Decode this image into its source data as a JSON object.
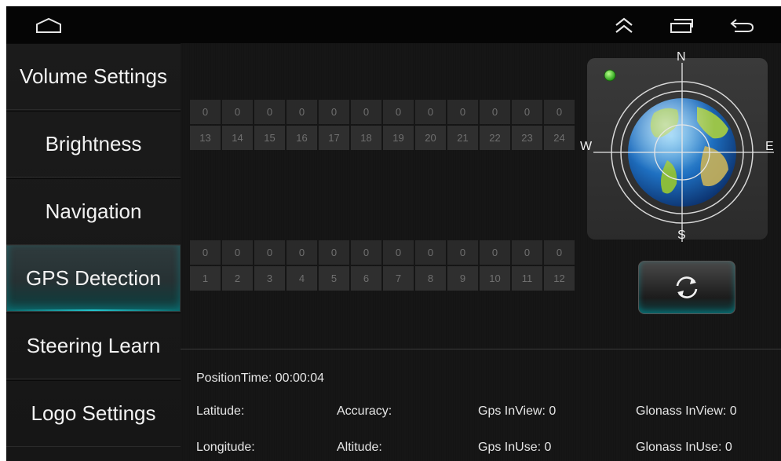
{
  "sidebar": {
    "items": [
      {
        "label": "Volume Settings"
      },
      {
        "label": "Brightness"
      },
      {
        "label": "Navigation"
      },
      {
        "label": "GPS Detection"
      },
      {
        "label": "Steering Learn"
      },
      {
        "label": "Logo Settings"
      }
    ],
    "active_index": 3
  },
  "satellites": {
    "upper": {
      "values": [
        "0",
        "0",
        "0",
        "0",
        "0",
        "0",
        "0",
        "0",
        "0",
        "0",
        "0",
        "0"
      ],
      "numbers": [
        "13",
        "14",
        "15",
        "16",
        "17",
        "18",
        "19",
        "20",
        "21",
        "22",
        "23",
        "24"
      ]
    },
    "lower": {
      "values": [
        "0",
        "0",
        "0",
        "0",
        "0",
        "0",
        "0",
        "0",
        "0",
        "0",
        "0",
        "0"
      ],
      "numbers": [
        "1",
        "2",
        "3",
        "4",
        "5",
        "6",
        "7",
        "8",
        "9",
        "10",
        "11",
        "12"
      ]
    }
  },
  "compass": {
    "n": "N",
    "s": "S",
    "w": "W",
    "e": "E",
    "status_color": "#3ecf2a"
  },
  "info": {
    "position_time": "PositionTime: 00:00:04",
    "latitude": "Latitude:",
    "longitude": "Longitude:",
    "accuracy": "Accuracy:",
    "altitude": "Altitude:",
    "gps_inview": "Gps InView: 0",
    "gps_inuse": "Gps InUse: 0",
    "glonass_inview": "Glonass InView: 0",
    "glonass_inuse": "Glonass InUse: 0"
  },
  "icons": {
    "home": "home-icon",
    "collapse": "double-chevron-up-icon",
    "recents": "recent-apps-icon",
    "back": "back-arrow-icon",
    "refresh": "refresh-icon"
  },
  "colors": {
    "accent": "#25c4cc"
  }
}
